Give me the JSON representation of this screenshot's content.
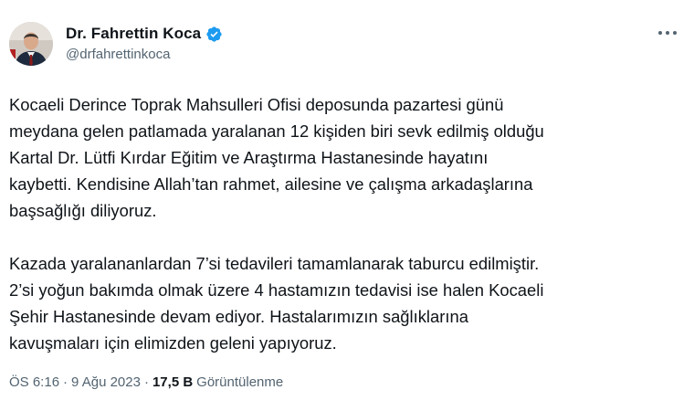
{
  "author": {
    "display_name": "Dr. Fahrettin Koca",
    "handle": "@drfahrettinkoca",
    "verified": true,
    "avatar_icon": "profile-photo",
    "verified_icon": "verified-badge-icon",
    "verified_color": "#1d9bf0"
  },
  "menu": {
    "more_icon": "more-horizontal-icon"
  },
  "tweet": {
    "paragraph_1_lines": [
      "Kocaeli Derince Toprak Mahsulleri Ofisi deposunda pazartesi günü",
      "meydana gelen patlamada yaralanan 12 kişiden biri sevk edilmiş olduğu",
      "Kartal Dr. Lütfi Kırdar Eğitim ve Araştırma Hastanesinde hayatını",
      "kaybetti. Kendisine Allah’tan rahmet, ailesine ve çalışma arkadaşlarına",
      "başsağlığı diliyoruz."
    ],
    "paragraph_2_lines": [
      "Kazada yaralananlardan 7’si tedavileri tamamlanarak taburcu edilmiştir.",
      "2’si yoğun bakımda olmak üzere 4 hastamızın tedavisi ise halen Kocaeli",
      "Şehir Hastanesinde devam ediyor. Hastalarımızın sağlıklarına",
      "kavuşmaları için elimizden geleni yapıyoruz."
    ]
  },
  "meta": {
    "time": "ÖS 6:16",
    "separator": "·",
    "date": "9 Ağu 2023",
    "views_count": "17,5 B",
    "views_label": "Görüntülenme"
  }
}
